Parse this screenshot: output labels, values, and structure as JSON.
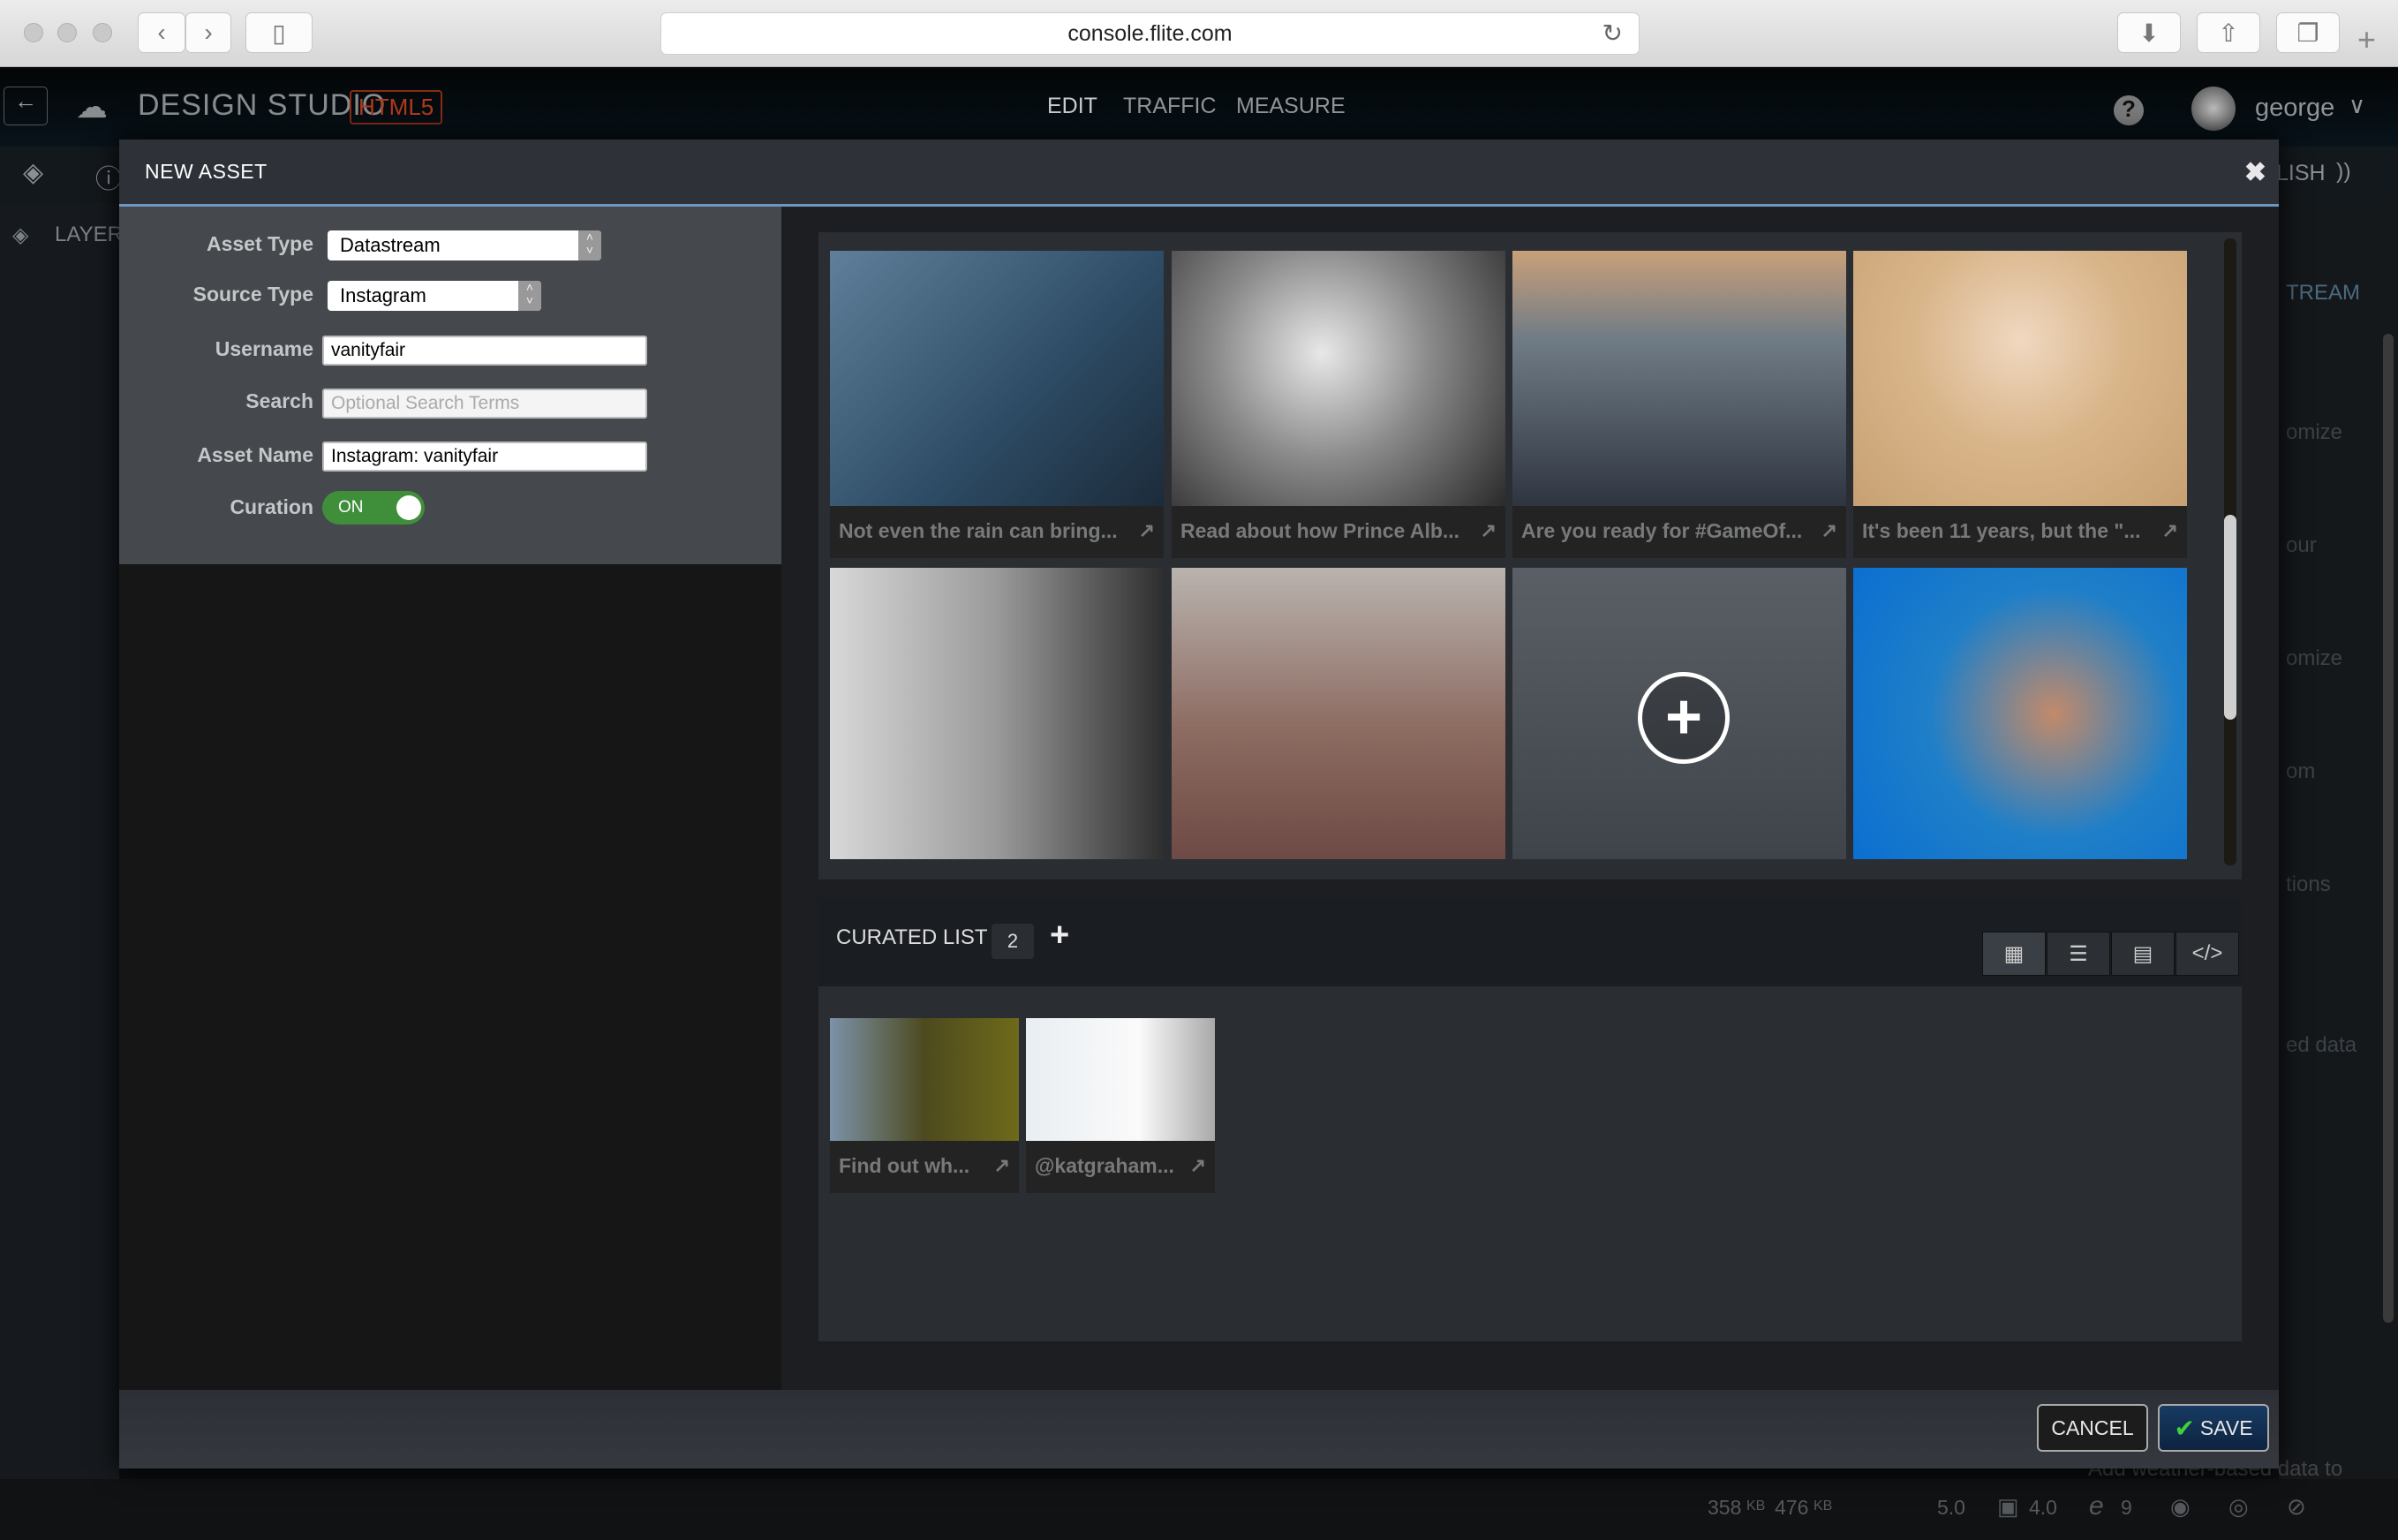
{
  "browser": {
    "url": "console.flite.com",
    "icons": [
      "back-icon",
      "forward-icon",
      "sidebar-icon",
      "reload-icon",
      "download-icon",
      "share-icon",
      "tabs-icon",
      "new-tab-icon"
    ]
  },
  "app": {
    "logo": "DESIGN STUDIO",
    "badge": "HTML5",
    "nav": [
      "EDIT",
      "TRAFFIC",
      "MEASURE"
    ],
    "user": "george",
    "publish_partial": "LISH",
    "layers_partial": "LAYER",
    "stream_partial": "TREAM",
    "right_ghost": [
      "omize",
      "our",
      "omize",
      "om",
      "tions",
      "ed data"
    ],
    "bottom_ghost": "Add weather-based data to"
  },
  "status": {
    "size1": "358",
    "unit1": "KB",
    "size2": "476",
    "unit2": "KB",
    "ios": "5.0",
    "android": "4.0",
    "ie": "9"
  },
  "modal": {
    "title": "NEW ASSET",
    "close": "✖",
    "form": {
      "asset_type_label": "Asset Type",
      "asset_type": "Datastream",
      "source_type_label": "Source Type",
      "source_type": "Instagram",
      "username_label": "Username",
      "username": "vanityfair",
      "search_label": "Search",
      "search_placeholder": "Optional Search Terms",
      "asset_name_label": "Asset Name",
      "asset_name": "Instagram: vanityfair",
      "curation_label": "Curation",
      "curation": "ON"
    },
    "gallery": [
      {
        "caption": "Not even the rain can bring...",
        "bg": "linear-gradient(135deg,#5f7f9a,#2c4a63 60%,#1c2b3a)"
      },
      {
        "caption": "Read about how Prince Alb...",
        "bg": "radial-gradient(circle at 45% 40%,#e8e8e8,#8a8a8a 45%,#2a2a2a)"
      },
      {
        "caption": "Are you ready for #GameOf...",
        "bg": "linear-gradient(#c9a07a,#6f7b85 35%,#2f3540)"
      },
      {
        "caption": "It's been 11 years, but the \"...",
        "bg": "radial-gradient(circle at 50% 35%,#f0d8c0,#d9b58a 45%,#c7a173)"
      },
      {
        "caption": "",
        "bg": "linear-gradient(90deg,#d8d8d8,#9a9a9a 50%,#2e2e2e)"
      },
      {
        "caption": "",
        "bg": "linear-gradient(#b9b3ae,#8d6c62 55%,#6d4a44)"
      },
      {
        "caption": "",
        "bg": "linear-gradient(#5a5f66,#3f444a)",
        "add": "+"
      },
      {
        "caption": "",
        "bg": "radial-gradient(circle at 60% 50%,#c28a6a,#1f7fc8 50%,#0b6fd1)"
      }
    ],
    "curated": {
      "title": "CURATED LIST",
      "count": "2",
      "add": "+",
      "views": [
        "grid-view-icon",
        "list-view-icon",
        "card-view-icon",
        "code-view-icon"
      ],
      "items": [
        {
          "caption": "Find out wh...",
          "bg": "linear-gradient(90deg,#7b92a8,#4d4a1f 50%,#6e6a1a)"
        },
        {
          "caption": "@katgraham...",
          "bg": "linear-gradient(90deg,#e9eef2,#fafafa 60%,#a9a9a9)"
        }
      ]
    },
    "cancel": "CANCEL",
    "save": "SAVE",
    "accent": "#6e97bf",
    "toggle_color": "#3f8f3a"
  }
}
